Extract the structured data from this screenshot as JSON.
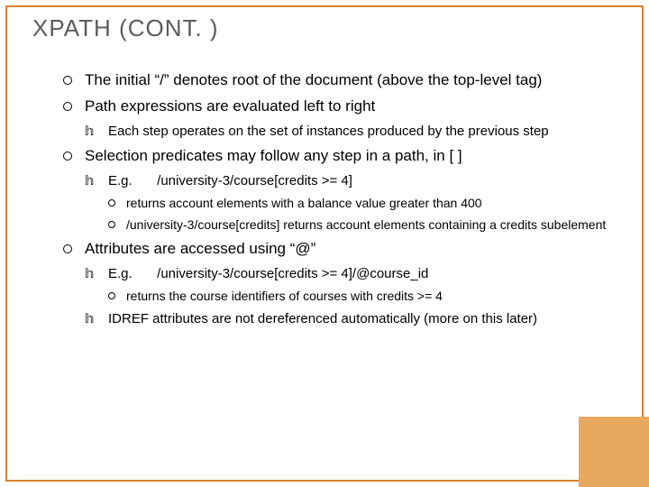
{
  "title": "XPATH (CONT. )",
  "items": [
    {
      "text": "The initial “/” denotes root of the document (above the top-level tag)"
    },
    {
      "text": "Path expressions are evaluated left to right",
      "sub": [
        {
          "text": "Each step operates on the set of instances produced by the previous step"
        }
      ]
    },
    {
      "text": "Selection predicates may follow any step in a path, in [ ]",
      "sub": [
        {
          "eg_label": "E.g.",
          "eg_value": "/university-3/course[credits >= 4]",
          "sub": [
            {
              "text": "returns account elements with a balance value greater than 400"
            },
            {
              "text": "/university-3/course[credits]  returns account elements containing a credits subelement"
            }
          ]
        }
      ]
    },
    {
      "text": "Attributes are accessed using “@”",
      "sub": [
        {
          "eg_label": "E.g.",
          "eg_value": "/university-3/course[credits >= 4]/@course_id",
          "sub": [
            {
              "text": "returns the course identifiers of courses with credits >= 4"
            }
          ]
        },
        {
          "text": "IDREF attributes are not dereferenced automatically (more on this later)"
        }
      ]
    }
  ]
}
